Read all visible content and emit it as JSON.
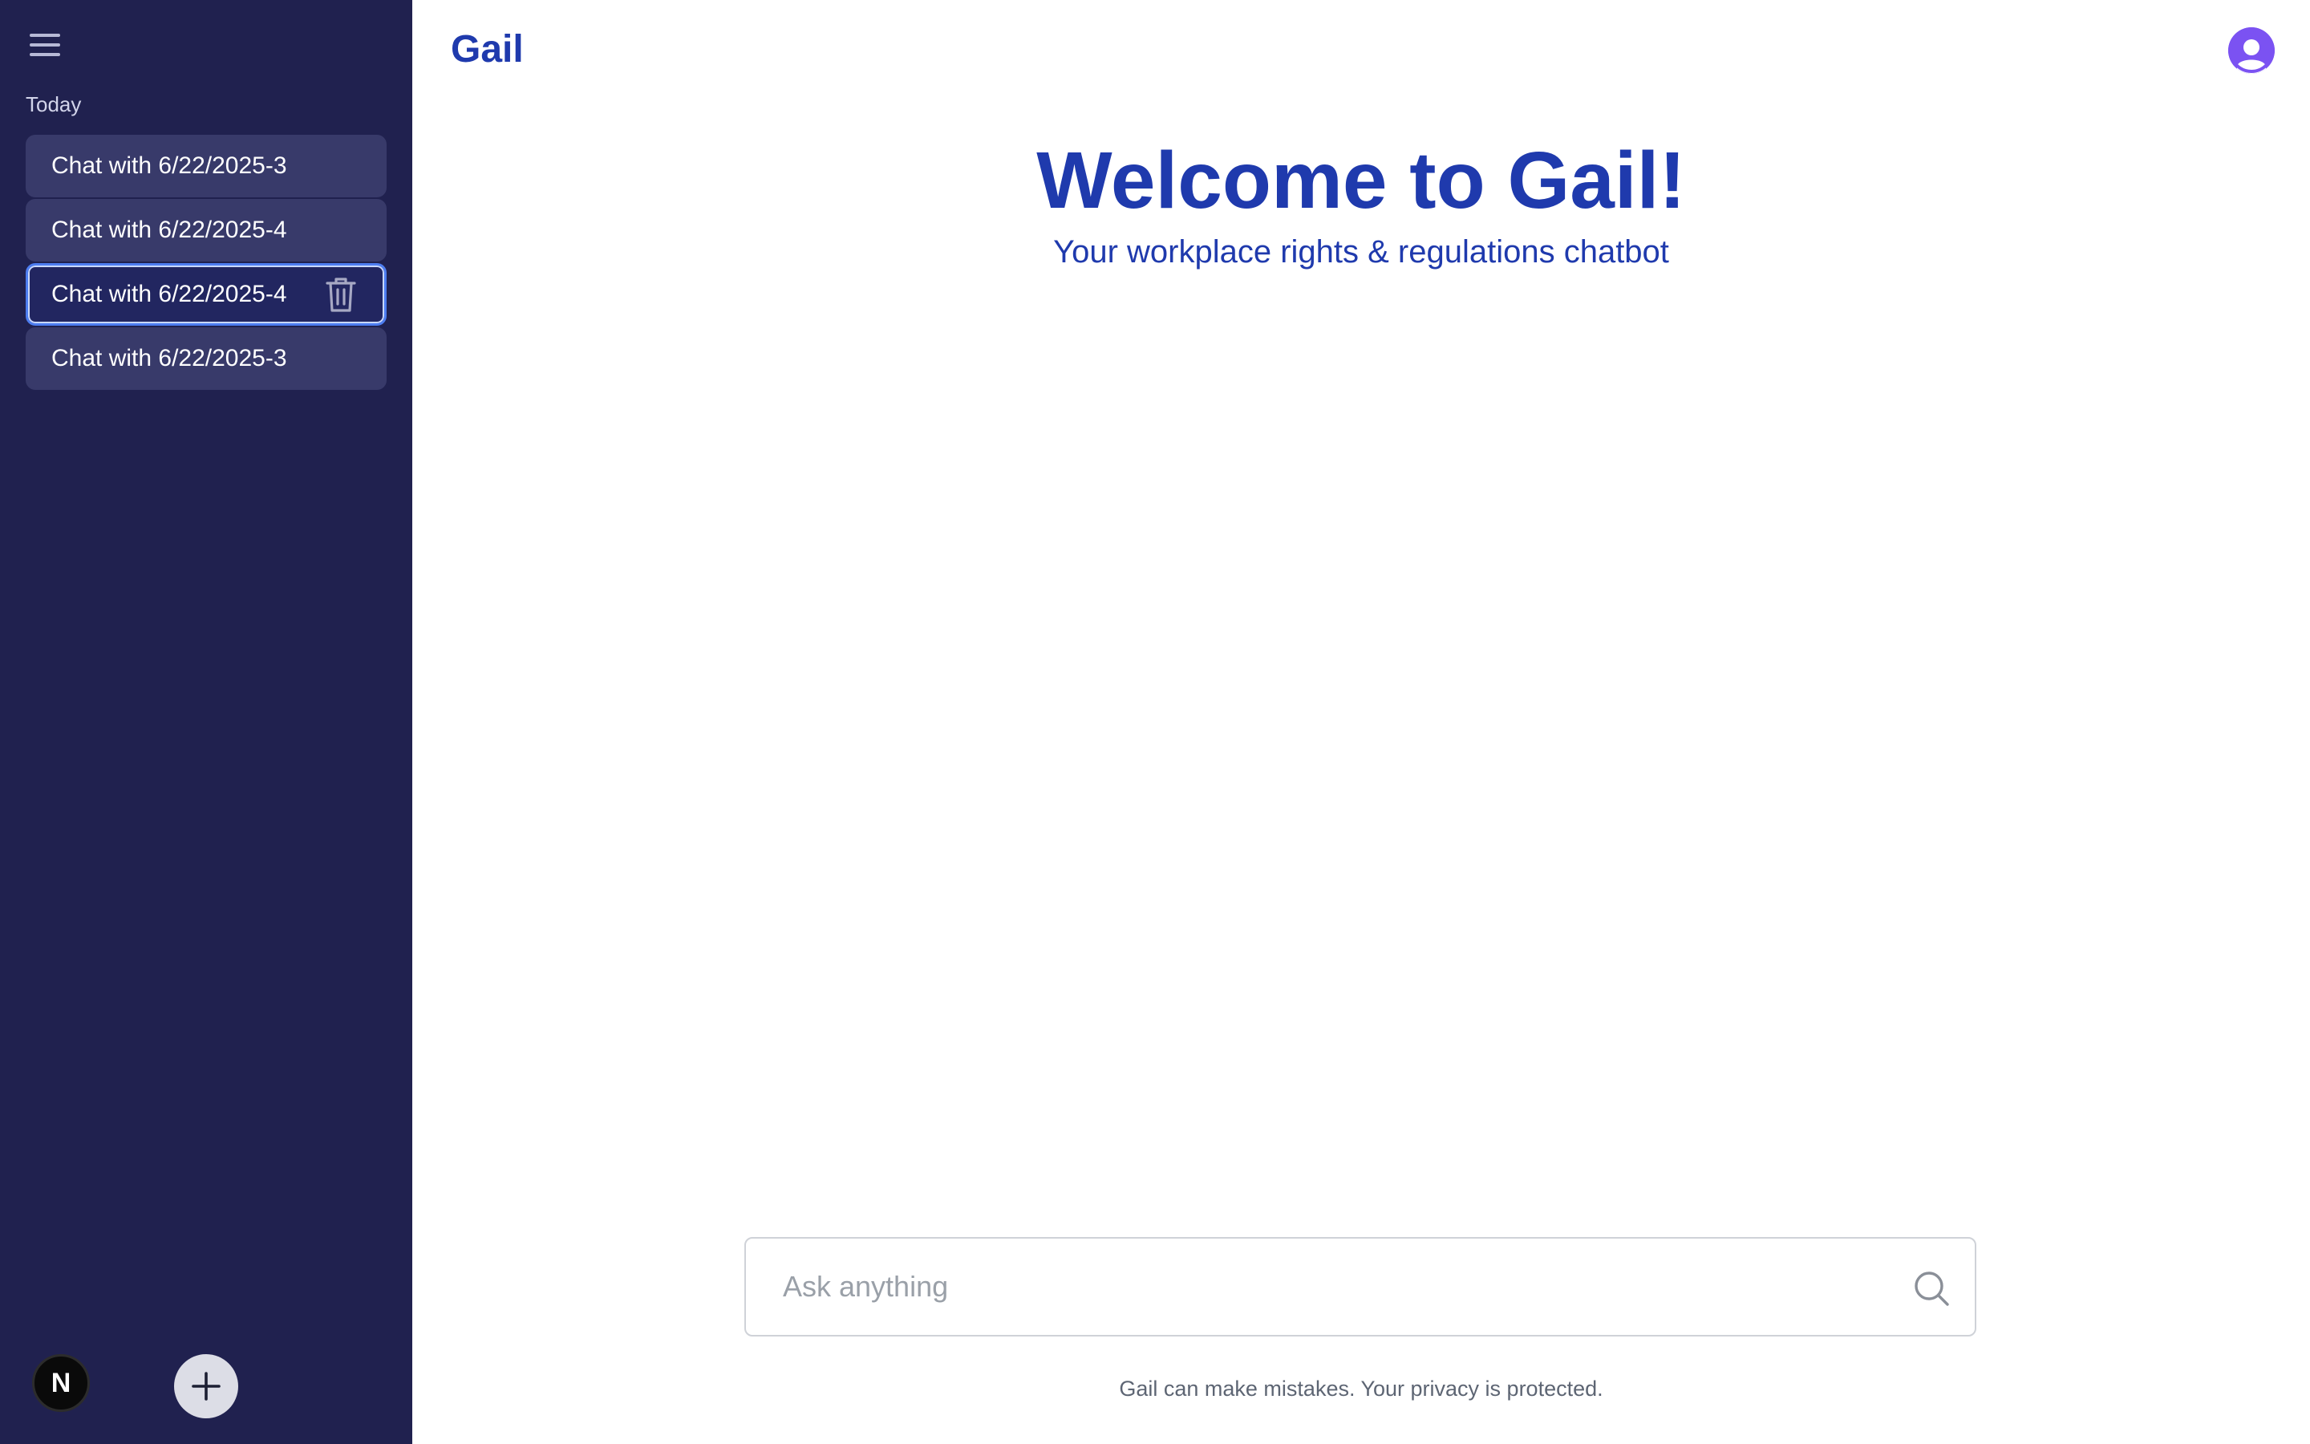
{
  "sidebar": {
    "menu_icon": "hamburger-menu-icon",
    "section_label": "Today",
    "chats": [
      {
        "label": "Chat with 6/22/2025-3",
        "active": false
      },
      {
        "label": "Chat with 6/22/2025-4",
        "active": false
      },
      {
        "label": "Chat with 6/22/2025-4",
        "active": true
      },
      {
        "label": "Chat with 6/22/2025-3",
        "active": false
      }
    ],
    "trash_icon": "trash-icon",
    "avatar_letter": "N",
    "new_chat_icon": "plus-icon"
  },
  "header": {
    "brand": "Gail",
    "profile_icon": "user-avatar-icon"
  },
  "main": {
    "welcome_title": "Welcome to Gail!",
    "subtitle": "Your workplace rights & regulations chatbot",
    "search": {
      "placeholder": "Ask anything",
      "value": ""
    },
    "disclaimer": "Gail can make mistakes. Your privacy is protected."
  },
  "colors": {
    "sidebar_bg": "#20214f",
    "chat_item_bg": "#383a6a",
    "active_border": "#4d7df0",
    "brand_blue": "#1f3aad",
    "avatar_purple": "#7b52f2"
  }
}
